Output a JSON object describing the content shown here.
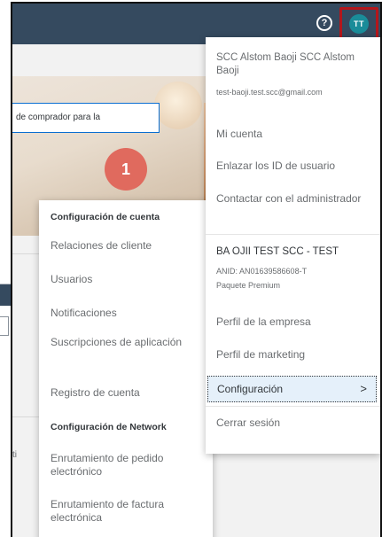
{
  "shell": {
    "help_icon_glyph": "?",
    "avatar_initials": "TT",
    "avatar_color": "#1a8c99",
    "highlight_color": "#b4161b"
  },
  "page": {
    "search_text": "de comprador para la",
    "step_number": "1",
    "partial_text": "ti"
  },
  "account_menu": {
    "user_name": "SCC Alstom Baoji SCC Alstom Baoji",
    "email": "test-baoji.test.scc@gmail.com",
    "my_account": "Mi cuenta",
    "link_user_ids": "Enlazar los ID de usuario",
    "contact_admin": "Contactar con el administrador",
    "company": "BA OJII TEST SCC - TEST",
    "anid": "ANID: AN01639586608-T",
    "package": "Paquete Premium",
    "company_profile": "Perfil de la empresa",
    "marketing_profile": "Perfil de marketing",
    "settings": "Configuración",
    "settings_chevron": ">",
    "logout": "Cerrar sesión"
  },
  "settings_submenu": {
    "account_heading": "Configuración de cuenta",
    "items": [
      "Relaciones de cliente",
      "Usuarios",
      "Notificaciones",
      "Suscripciones de aplicación",
      "Registro de cuenta"
    ],
    "network_heading": "Configuración de Network",
    "network_items": [
      "Enrutamiento de pedido electrónico",
      "Enrutamiento de factura electrónica"
    ]
  }
}
